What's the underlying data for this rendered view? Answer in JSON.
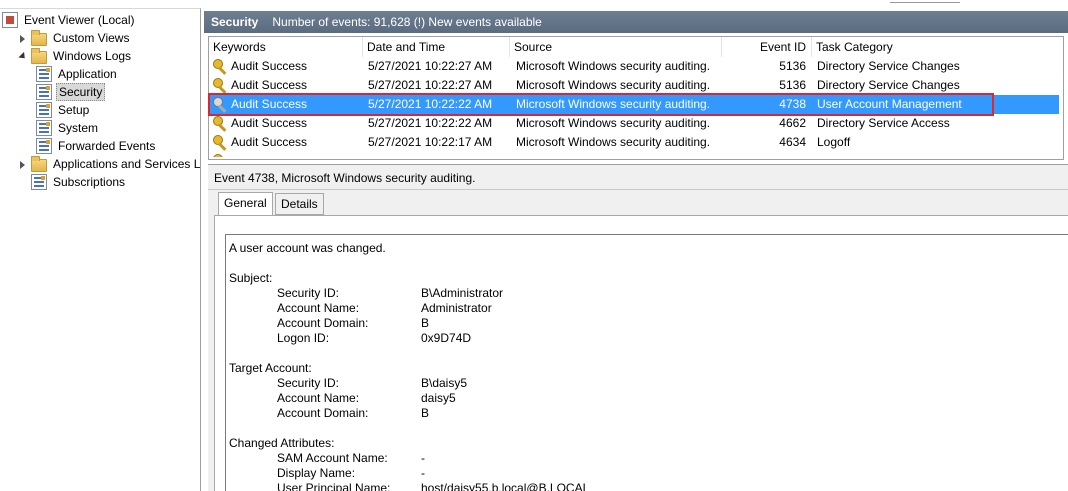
{
  "tree": {
    "items": [
      {
        "label": "Event Viewer (Local)",
        "icon": "event-viewer-icon",
        "expander": "none",
        "indent": 0
      },
      {
        "label": "Custom Views",
        "icon": "folder-icon",
        "expander": "collapsed",
        "indent": 1
      },
      {
        "label": "Windows Logs",
        "icon": "folder-icon",
        "expander": "expanded",
        "indent": 1
      },
      {
        "label": "Application",
        "icon": "log-icon",
        "expander": "none",
        "indent": 2
      },
      {
        "label": "Security",
        "icon": "log-icon",
        "expander": "none",
        "indent": 2,
        "selected": true
      },
      {
        "label": "Setup",
        "icon": "log-icon",
        "expander": "none",
        "indent": 2
      },
      {
        "label": "System",
        "icon": "log-icon",
        "expander": "none",
        "indent": 2
      },
      {
        "label": "Forwarded Events",
        "icon": "log-icon",
        "expander": "none",
        "indent": 2
      },
      {
        "label": "Applications and Services L",
        "icon": "folder-icon",
        "expander": "collapsed",
        "indent": 1
      },
      {
        "label": "Subscriptions",
        "icon": "log-icon",
        "expander": "none",
        "indent": 1
      }
    ]
  },
  "header": {
    "title": "Security",
    "info": "Number of events: 91,628 (!) New events available"
  },
  "list": {
    "columns": [
      "Keywords",
      "Date and Time",
      "Source",
      "Event ID",
      "Task Category"
    ],
    "rows": [
      {
        "keywords": "Audit Success",
        "datetime": "5/27/2021 10:22:27 AM",
        "source": "Microsoft Windows security auditing.",
        "event_id": "5136",
        "task": "Directory Service Changes"
      },
      {
        "keywords": "Audit Success",
        "datetime": "5/27/2021 10:22:27 AM",
        "source": "Microsoft Windows security auditing.",
        "event_id": "5136",
        "task": "Directory Service Changes"
      },
      {
        "keywords": "Audit Success",
        "datetime": "5/27/2021 10:22:22 AM",
        "source": "Microsoft Windows security auditing.",
        "event_id": "4738",
        "task": "User Account Management",
        "selected": true
      },
      {
        "keywords": "Audit Success",
        "datetime": "5/27/2021 10:22:22 AM",
        "source": "Microsoft Windows security auditing.",
        "event_id": "4662",
        "task": "Directory Service Access"
      },
      {
        "keywords": "Audit Success",
        "datetime": "5/27/2021 10:22:17 AM",
        "source": "Microsoft Windows security auditing.",
        "event_id": "4634",
        "task": "Logoff"
      }
    ]
  },
  "detail": {
    "title": "Event 4738, Microsoft Windows security auditing.",
    "tabs": [
      "General",
      "Details"
    ],
    "active_tab": "General",
    "summary": "A user account was changed.",
    "sections": [
      {
        "heading": "Subject:",
        "fields": [
          {
            "label": "Security ID:",
            "value": "B\\Administrator"
          },
          {
            "label": "Account Name:",
            "value": "Administrator"
          },
          {
            "label": "Account Domain:",
            "value": "B"
          },
          {
            "label": "Logon ID:",
            "value": "0x9D74D"
          }
        ]
      },
      {
        "heading": "Target Account:",
        "fields": [
          {
            "label": "Security ID:",
            "value": "B\\daisy5"
          },
          {
            "label": "Account Name:",
            "value": "daisy5"
          },
          {
            "label": "Account Domain:",
            "value": "B"
          }
        ]
      },
      {
        "heading": "Changed Attributes:",
        "fields": [
          {
            "label": "SAM Account Name:",
            "value": "-"
          },
          {
            "label": "Display Name:",
            "value": "-"
          },
          {
            "label": "User Principal Name:",
            "value": "host/daisy55.b.local@B.LOCAL"
          }
        ]
      }
    ]
  },
  "colors": {
    "selection": "#3399ff",
    "highlight_box": "#e0262c",
    "header_bar": "#5f6f84"
  }
}
